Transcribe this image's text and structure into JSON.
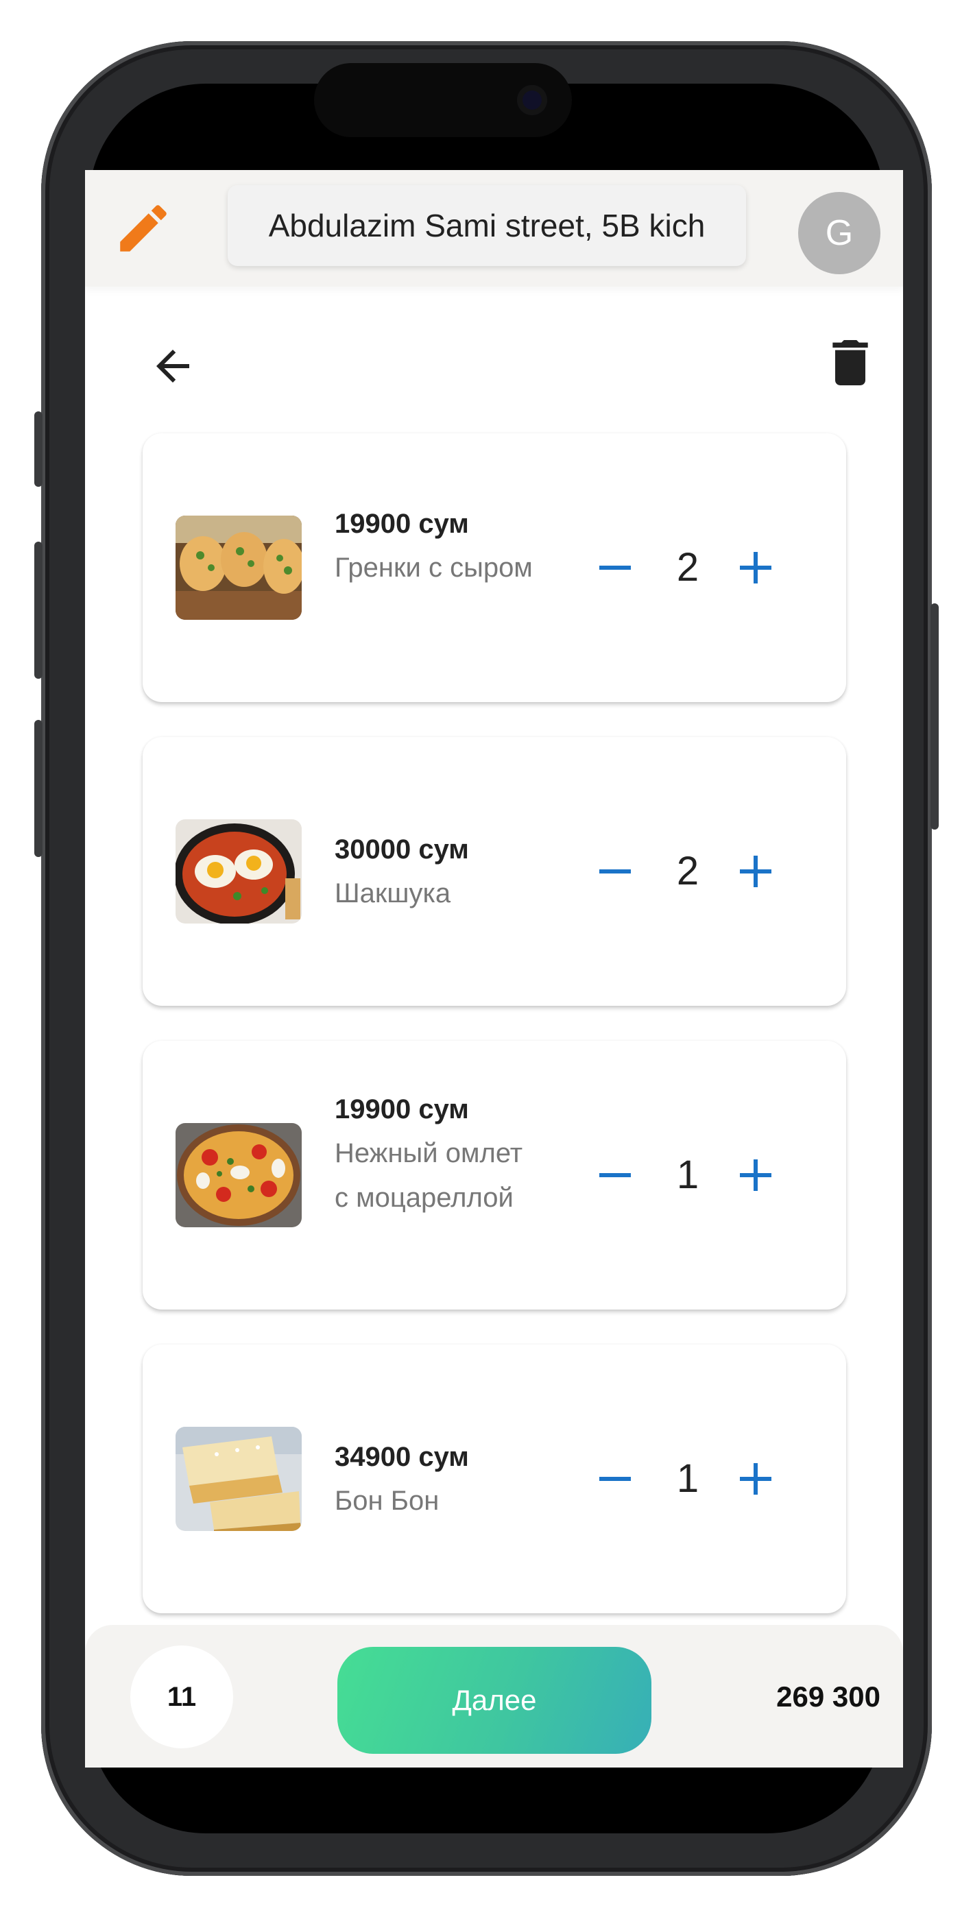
{
  "header": {
    "address": "Abdulazim Sami street, 5B kich",
    "avatar_letter": "G"
  },
  "cart": {
    "items": [
      {
        "price": "19900 сум",
        "name": "Гренки с сыром",
        "quantity": "2"
      },
      {
        "price": "30000 сум",
        "name": "Шакшука",
        "quantity": "2"
      },
      {
        "price": "19900 сум",
        "name": "Нежный омлет с моцареллой",
        "quantity": "1"
      },
      {
        "price": "34900 сум",
        "name": "Бон Бон",
        "quantity": "1"
      }
    ]
  },
  "footer": {
    "item_count": "11",
    "next_label": "Далее",
    "total": "269 300"
  },
  "colors": {
    "accent_orange": "#f07a1a",
    "stepper_blue": "#1a73c8",
    "button_gradient_start": "#46dd94",
    "button_gradient_end": "#37afb7"
  },
  "icons": [
    "edit-icon",
    "back-arrow-icon",
    "trash-icon",
    "minus-icon",
    "plus-icon"
  ]
}
